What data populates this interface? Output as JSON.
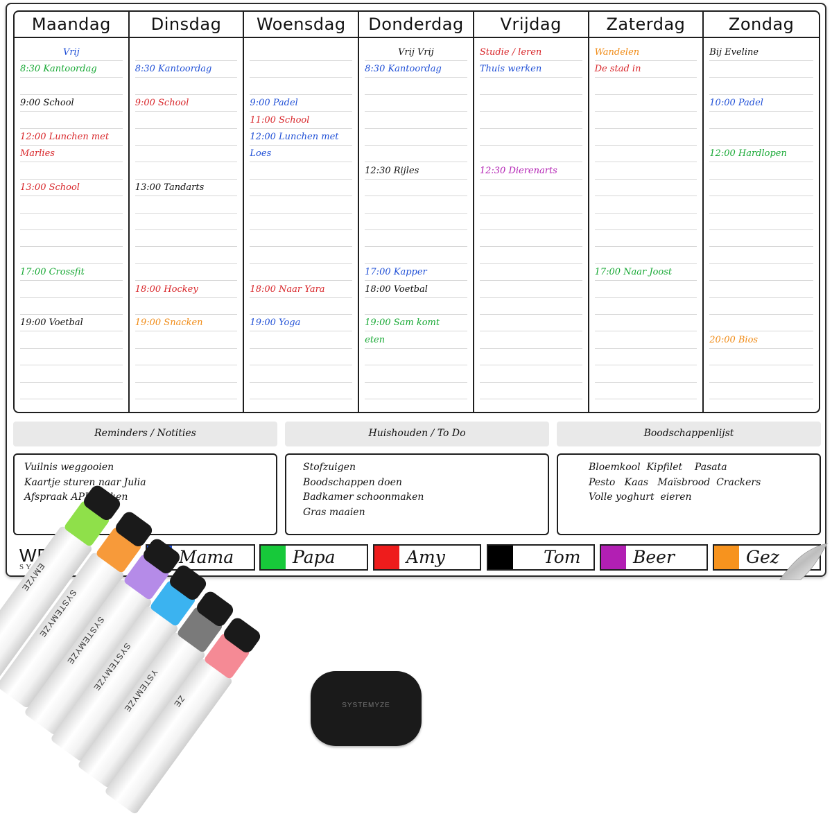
{
  "days": [
    {
      "name": "Maandag",
      "entries": [
        {
          "text": "Vrij",
          "color": "#1f4fd6",
          "row": 0,
          "center": true
        },
        {
          "text": "8:30 Kantoordag",
          "color": "#17a834",
          "row": 1
        },
        {
          "text": "9:00 School",
          "color": "#111111",
          "row": 3
        },
        {
          "text": "12:00 Lunchen met",
          "color": "#d8262a",
          "row": 5
        },
        {
          "text": "Marlies",
          "color": "#d8262a",
          "row": 6
        },
        {
          "text": "13:00 School",
          "color": "#d8262a",
          "row": 8
        },
        {
          "text": "17:00 Crossfit",
          "color": "#17a834",
          "row": 13
        },
        {
          "text": "19:00 Voetbal",
          "color": "#111111",
          "row": 16
        }
      ]
    },
    {
      "name": "Dinsdag",
      "entries": [
        {
          "text": "8:30 Kantoordag",
          "color": "#1f4fd6",
          "row": 1
        },
        {
          "text": "9:00 School",
          "color": "#d8262a",
          "row": 3
        },
        {
          "text": "13:00 Tandarts",
          "color": "#111111",
          "row": 8
        },
        {
          "text": "18:00 Hockey",
          "color": "#d8262a",
          "row": 14
        },
        {
          "text": "19:00 Snacken",
          "color": "#f08a14",
          "row": 16
        }
      ]
    },
    {
      "name": "Woensdag",
      "entries": [
        {
          "text": "9:00 Padel",
          "color": "#1f4fd6",
          "row": 3
        },
        {
          "text": "11:00 School",
          "color": "#d8262a",
          "row": 4
        },
        {
          "text": "12:00 Lunchen met",
          "color": "#1f4fd6",
          "row": 5
        },
        {
          "text": "Loes",
          "color": "#1f4fd6",
          "row": 6
        },
        {
          "text": "18:00 Naar Yara",
          "color": "#d8262a",
          "row": 14
        },
        {
          "text": "19:00 Yoga",
          "color": "#1f4fd6",
          "row": 16
        }
      ]
    },
    {
      "name": "Donderdag",
      "entries": [
        {
          "text": "Vrij  Vrij",
          "color": "#111111",
          "row": 0,
          "center": true
        },
        {
          "text": "8:30 Kantoordag",
          "color": "#1f4fd6",
          "row": 1
        },
        {
          "text": "12:30 Rijles",
          "color": "#111111",
          "row": 7
        },
        {
          "text": "17:00 Kapper",
          "color": "#1f4fd6",
          "row": 13
        },
        {
          "text": "18:00 Voetbal",
          "color": "#111111",
          "row": 14
        },
        {
          "text": "19:00 Sam komt",
          "color": "#17a834",
          "row": 16
        },
        {
          "text": "eten",
          "color": "#17a834",
          "row": 17
        }
      ]
    },
    {
      "name": "Vrijdag",
      "entries": [
        {
          "text": "Studie / leren",
          "color": "#d8262a",
          "row": 0
        },
        {
          "text": "Thuis werken",
          "color": "#1f4fd6",
          "row": 1
        },
        {
          "text": "12:30 Dierenarts",
          "color": "#b21fb3",
          "row": 7
        }
      ]
    },
    {
      "name": "Zaterdag",
      "entries": [
        {
          "text": "Wandelen",
          "color": "#f08a14",
          "row": 0
        },
        {
          "text": "De stad in",
          "color": "#d8262a",
          "row": 1
        },
        {
          "text": "17:00 Naar Joost",
          "color": "#17a834",
          "row": 13
        }
      ]
    },
    {
      "name": "Zondag",
      "entries": [
        {
          "text": "Bij Eveline",
          "color": "#111111",
          "row": 0
        },
        {
          "text": "10:00 Padel",
          "color": "#1f4fd6",
          "row": 3
        },
        {
          "text": "12:00 Hardlopen",
          "color": "#17a834",
          "row": 6
        },
        {
          "text": "20:00 Bios",
          "color": "#f08a14",
          "row": 17
        }
      ]
    }
  ],
  "sections": [
    {
      "title": "Reminders / Notities",
      "lines": [
        "Vuilnis weggooien",
        "Kaartje sturen naar Julia",
        "Afspraak APK maken"
      ]
    },
    {
      "title": "Huishouden / To Do",
      "lines": [
        "Stofzuigen",
        "Boodschappen doen",
        "Badkamer schoonmaken",
        "Gras maaien"
      ]
    },
    {
      "title": "Boodschappenlijst",
      "lines": [
        "Bloemkool  Kipfilet    Pasata",
        "Pesto   Kaas   Maïsbrood  Crackers",
        "Volle yoghurt  eieren"
      ]
    }
  ],
  "legend": [
    {
      "name": "Mama",
      "color": "#1f4fd6"
    },
    {
      "name": "Papa",
      "color": "#17c93a"
    },
    {
      "name": "Amy",
      "color": "#ee1c1c"
    },
    {
      "name": "Tom",
      "color": "#000000"
    },
    {
      "name": "Beer",
      "color": "#b21fb3"
    },
    {
      "name": "Gez",
      "color": "#f7931e"
    }
  ],
  "brand": {
    "name": "WEEK",
    "sub": "SYSTEMY"
  },
  "markers": [
    {
      "label": "EMYZE",
      "color": "#8fe04a"
    },
    {
      "label": "SYSTEMYZE",
      "color": "#f79a3a"
    },
    {
      "label": "SYSTEMYZE",
      "color": "#b58be8"
    },
    {
      "label": "SYSTEMYZE",
      "color": "#3bb3f0"
    },
    {
      "label": "YSTEMYZE",
      "color": "#7a7a7a"
    },
    {
      "label": "ZE",
      "color": "#f58a95"
    }
  ],
  "eraser": {
    "label": "SYSTEMYZE"
  }
}
